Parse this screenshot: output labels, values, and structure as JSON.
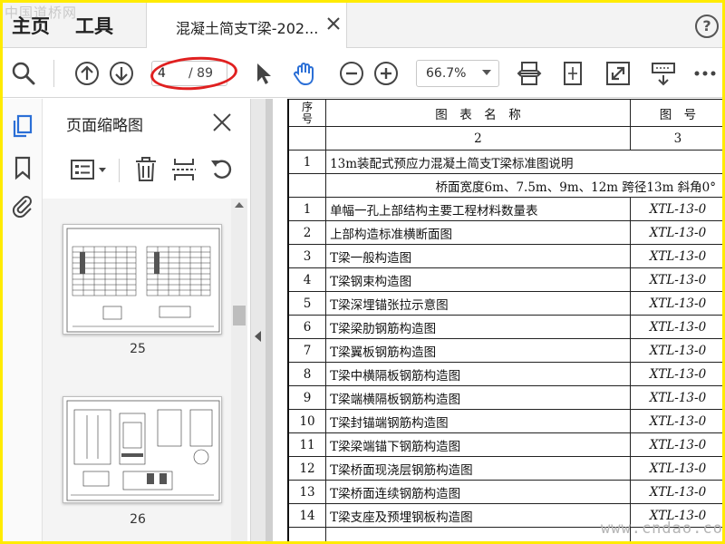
{
  "watermark_top": "中国道桥网",
  "watermark_bottom": "www.cndao.com",
  "tabbar": {
    "home": "主页",
    "tools": "工具",
    "doc_tab_title": "混凝土简支T梁-202...",
    "help": "?"
  },
  "toolbar": {
    "current_page": "4",
    "total_pages": "/ 89",
    "zoom": "66.7%"
  },
  "panel": {
    "title": "页面缩略图",
    "thumbnails": [
      {
        "label": "25"
      },
      {
        "label": "26"
      }
    ]
  },
  "doc_table": {
    "header_partial_no": "序\n号",
    "header_name": "图　表　名　称",
    "header_code": "图　号",
    "index_row": {
      "no": "",
      "name": "2",
      "code": "3"
    },
    "intro": {
      "no": "1",
      "name": "13m装配式预应力混凝土简支T梁标准图说明"
    },
    "subtitle": "桥面宽度6m、7.5m、9m、12m 跨径13m  斜角0°",
    "rows": [
      {
        "no": "1",
        "name": "单幅一孔上部结构主要工程材料数量表",
        "code": "XTL-13-0"
      },
      {
        "no": "2",
        "name": "上部构造标准横断面图",
        "code": "XTL-13-0"
      },
      {
        "no": "3",
        "name": "T梁一般构造图",
        "code": "XTL-13-0"
      },
      {
        "no": "4",
        "name": "T梁钢束构造图",
        "code": "XTL-13-0"
      },
      {
        "no": "5",
        "name": "T梁深埋锚张拉示意图",
        "code": "XTL-13-0"
      },
      {
        "no": "6",
        "name": "T梁梁肋钢筋构造图",
        "code": "XTL-13-0"
      },
      {
        "no": "7",
        "name": "T梁翼板钢筋构造图",
        "code": "XTL-13-0"
      },
      {
        "no": "8",
        "name": "T梁中横隔板钢筋构造图",
        "code": "XTL-13-0"
      },
      {
        "no": "9",
        "name": "T梁端横隔板钢筋构造图",
        "code": "XTL-13-0"
      },
      {
        "no": "10",
        "name": "T梁封锚端钢筋构造图",
        "code": "XTL-13-0"
      },
      {
        "no": "11",
        "name": "T梁梁端锚下钢筋构造图",
        "code": "XTL-13-0"
      },
      {
        "no": "12",
        "name": "T梁桥面现浇层钢筋构造图",
        "code": "XTL-13-0"
      },
      {
        "no": "13",
        "name": "T梁桥面连续钢筋构造图",
        "code": "XTL-13-0"
      },
      {
        "no": "14",
        "name": "T梁支座及预埋钢板构造图",
        "code": "XTL-13-0"
      }
    ]
  },
  "colors": {
    "frame": "#ffeb00",
    "accent_blue": "#2b6fd6",
    "highlight_red": "#e02020"
  },
  "icons": {
    "search": "search-icon",
    "prev_page": "arrow-up-circle-icon",
    "next_page": "arrow-down-circle-icon",
    "select": "pointer-icon",
    "hand": "hand-icon",
    "zoom_out": "zoom-out-icon",
    "zoom_in": "zoom-in-icon",
    "fit_width": "fit-width-icon",
    "fit_page": "fit-page-icon",
    "fullscreen": "fullscreen-icon",
    "read_mode": "read-mode-icon",
    "more": "more-icon",
    "thumbnails": "thumbnails-icon",
    "bookmark": "bookmark-icon",
    "attachment": "paperclip-icon",
    "options": "options-icon",
    "delete": "trash-icon",
    "split": "split-icon",
    "rotate": "rotate-icon",
    "close": "close-icon"
  }
}
